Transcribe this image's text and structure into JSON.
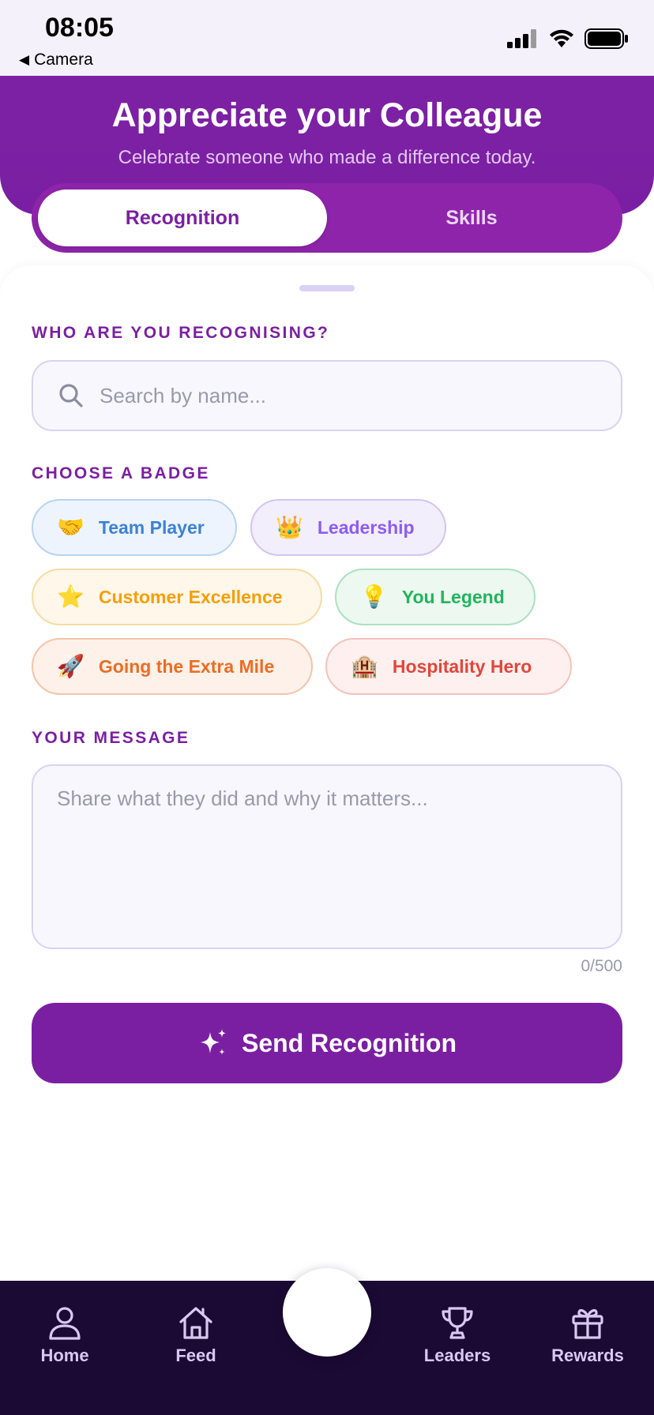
{
  "status_bar": {
    "time": "08:05",
    "back_label": "Camera"
  },
  "header": {
    "title": "Appreciate your Colleague",
    "subtitle": "Celebrate someone who made a difference today."
  },
  "tabs": [
    {
      "label": "Recognition",
      "active": true
    },
    {
      "label": "Skills",
      "active": false
    }
  ],
  "recipient": {
    "section_label": "WHO ARE YOU RECOGNISING?",
    "search_placeholder": "Search by name...",
    "search_icon": "search-icon"
  },
  "badges": {
    "section_label": "CHOOSE A BADGE",
    "items": [
      {
        "label": "Team Player",
        "emoji": "🤝",
        "color": "#3b82d6"
      },
      {
        "label": "Leadership",
        "emoji": "👑",
        "color": "#8b5cf6"
      },
      {
        "label": "Customer Excellence",
        "emoji": "⭐",
        "color": "#f59e0b"
      },
      {
        "label": "You Legend",
        "emoji": "💡",
        "color": "#22b45c"
      },
      {
        "label": "Going the Extra Mile",
        "emoji": "🚀",
        "color": "#ea6d23"
      },
      {
        "label": "Hospitality Hero",
        "emoji": "🏨",
        "color": "#e3453a"
      }
    ]
  },
  "message": {
    "section_label": "YOUR MESSAGE",
    "placeholder": "Share what they did and why it matters...",
    "char_count": "0/500"
  },
  "send_button": {
    "label": "Send Recognition",
    "icon": "sparkles-icon"
  },
  "bottom_nav": {
    "items": [
      {
        "label": "Home",
        "icon": "user-icon"
      },
      {
        "label": "Feed",
        "icon": "home-icon"
      },
      {
        "label": "Leaders",
        "icon": "trophy-icon"
      },
      {
        "label": "Rewards",
        "icon": "gift-icon"
      }
    ]
  },
  "colors": {
    "brand_purple": "#7b1fa2",
    "nav_background": "#1b0a33"
  }
}
